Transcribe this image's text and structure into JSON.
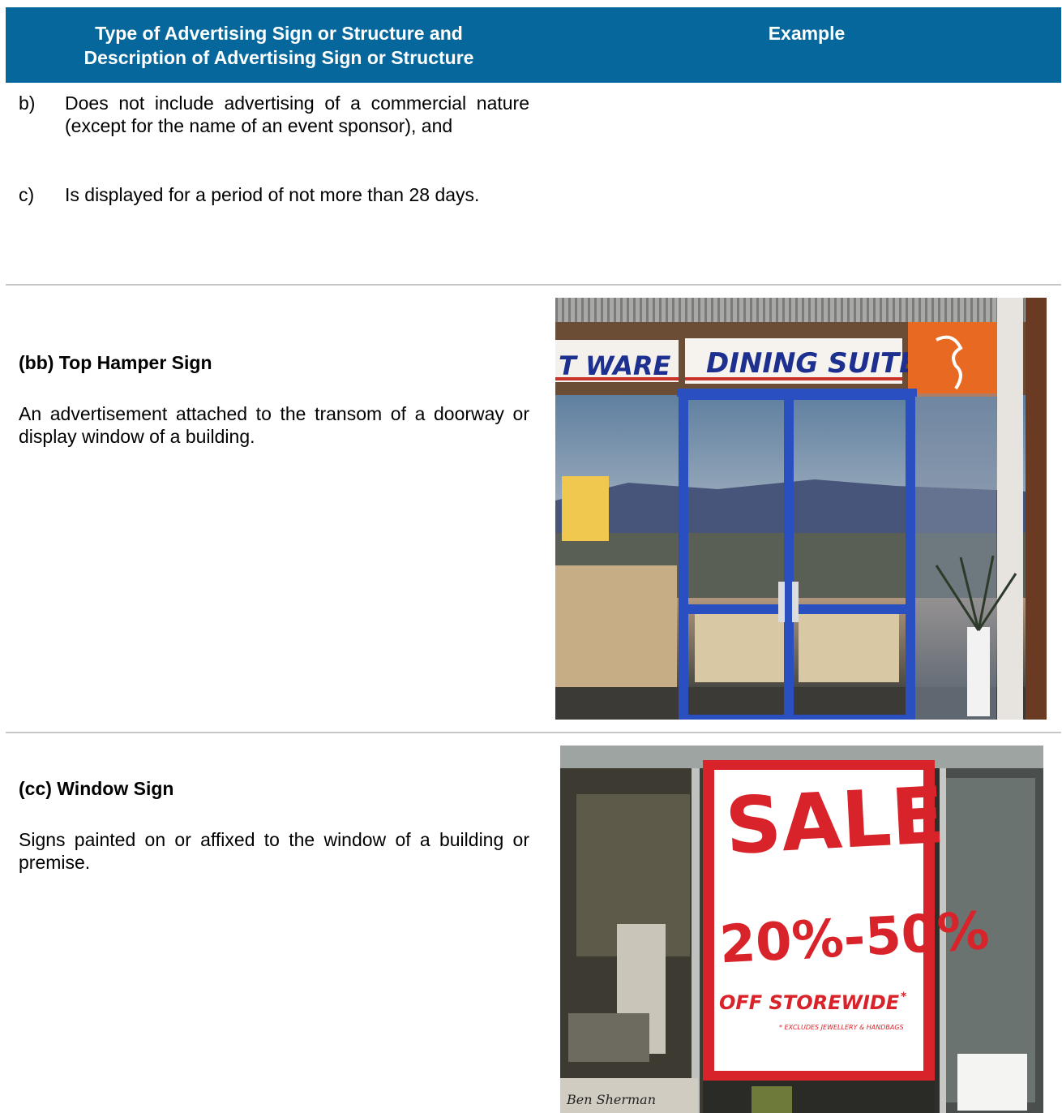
{
  "header": {
    "col1_line1": "Type of Advertising Sign or Structure and",
    "col1_line2": "Description of Advertising Sign or Structure",
    "col2": "Example"
  },
  "continued_items": [
    {
      "mark": "b)",
      "text": "Does not include advertising of a commercial nature (except for the name of an event sponsor), and"
    },
    {
      "mark": "c)",
      "text": "Is displayed for a period of not more than 28 days."
    }
  ],
  "sections": [
    {
      "title": "(bb) Top Hamper Sign",
      "description": "An advertisement attached to the transom of a doorway or display window of a building.",
      "photo_text": {
        "sign_main": "DINING SUITES",
        "sign_left": "T WARE"
      }
    },
    {
      "title": "(cc) Window Sign",
      "description": "Signs painted on or affixed to the window of a building or premise.",
      "photo_text": {
        "line1": "SALE",
        "line2": "20%-50%",
        "line3": "OFF STOREWIDE",
        "asterisk": "*",
        "footnote": "* EXCLUDES JEWELLERY & HANDBAGS",
        "brand": "Ben Sherman"
      }
    }
  ],
  "colors": {
    "header_bg": "#05679b",
    "divider": "#c8c8c8",
    "door_frame": "#2a4fc0",
    "sale_red": "#d8232a"
  }
}
